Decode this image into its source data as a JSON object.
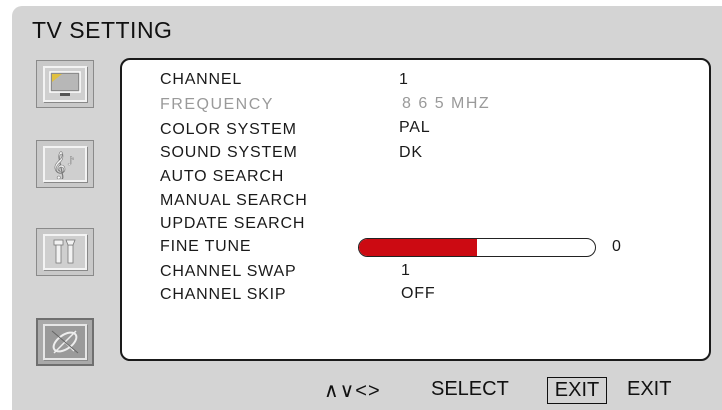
{
  "title": "TV SETTING",
  "sidebar": {
    "items": [
      {
        "icon": "tv-picture-icon",
        "active": false
      },
      {
        "icon": "music-note-icon",
        "active": false
      },
      {
        "icon": "tools-icon",
        "active": false
      },
      {
        "icon": "satellite-dish-icon",
        "active": true
      }
    ]
  },
  "menu": {
    "channel": {
      "label": "CHANNEL",
      "value": "1"
    },
    "frequency": {
      "label": "FREQUENCY",
      "value": "8 6 5 MHZ"
    },
    "color_system": {
      "label": "COLOR SYSTEM",
      "value": "PAL"
    },
    "sound_system": {
      "label": "SOUND SYSTEM",
      "value": "DK"
    },
    "auto_search": {
      "label": "AUTO SEARCH"
    },
    "manual_search": {
      "label": "MANUAL SEARCH"
    },
    "update_search": {
      "label": "UPDATE SEARCH"
    },
    "fine_tune": {
      "label": "FINE TUNE",
      "value": "0",
      "bar_fraction": 0.5
    },
    "channel_swap": {
      "label": "CHANNEL SWAP",
      "value": "1"
    },
    "channel_skip": {
      "label": "CHANNEL SKIP",
      "value": "OFF"
    }
  },
  "footer": {
    "nav_keys": "∧∨<>",
    "select_label": "SELECT",
    "exit_key": "EXIT",
    "exit_label": "EXIT"
  },
  "colors": {
    "accent": "#cc0a12",
    "background": "#d4d4d4",
    "panel": "#ffffff"
  }
}
